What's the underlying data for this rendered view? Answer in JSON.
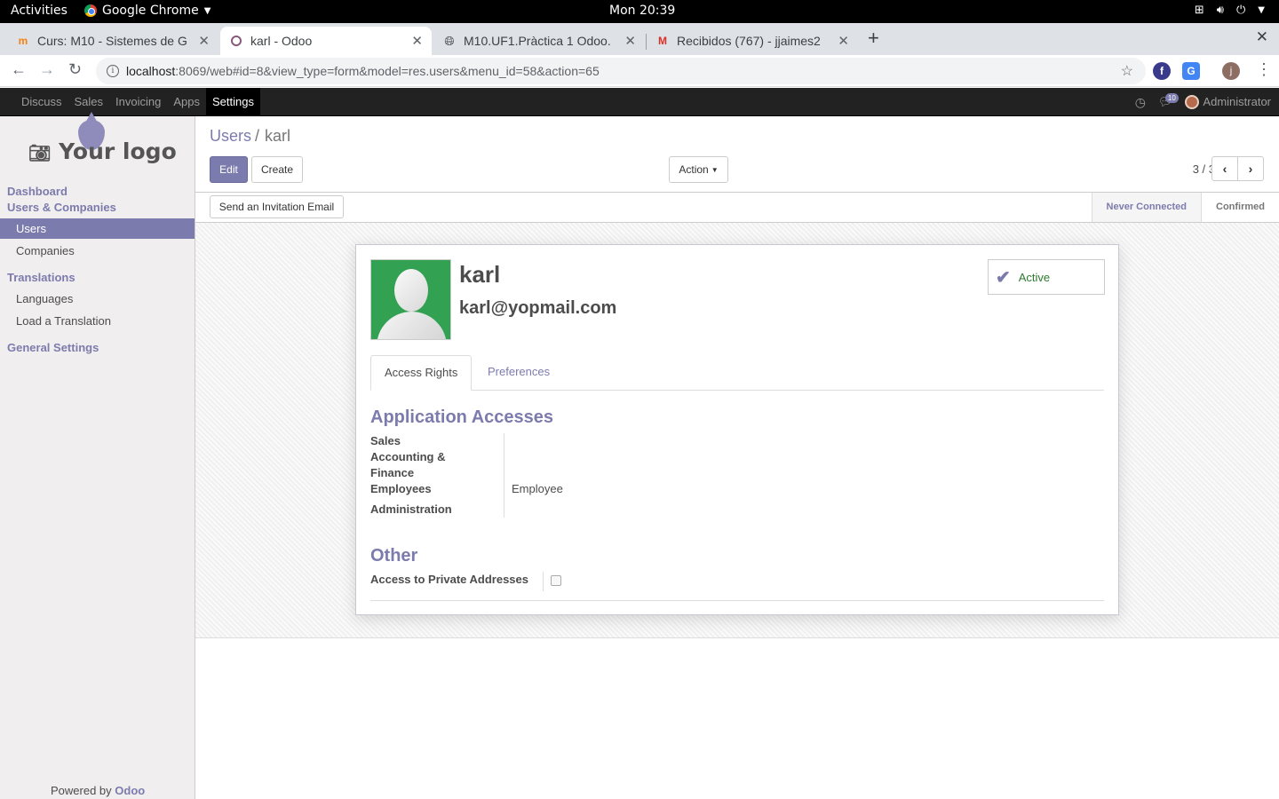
{
  "os": {
    "activities": "Activities",
    "app_name": "Google Chrome",
    "clock": "Mon 20:39"
  },
  "browser": {
    "tabs": [
      {
        "title": "Curs: M10 - Sistemes de G",
        "icon": "moodle-icon"
      },
      {
        "title": "karl - Odoo",
        "icon": "odoo-icon"
      },
      {
        "title": "M10.UF1.Pràctica 1 Odoo.",
        "icon": "globe-icon"
      },
      {
        "title": "Recibidos (767) - jjaimes2",
        "icon": "gmail-icon"
      }
    ],
    "url_host": "localhost",
    "url_path": ":8069/web#id=8&view_type=form&model=res.users&menu_id=58&action=65",
    "profile_initial": "j"
  },
  "odoo_nav": {
    "menus": [
      "Discuss",
      "Sales",
      "Invoicing",
      "Apps",
      "Settings"
    ],
    "active_menu": "Settings",
    "chat_count": "10",
    "user": "Administrator"
  },
  "sidebar": {
    "logo_text": "Your logo",
    "sections": {
      "dashboard": "Dashboard",
      "users_companies": "Users & Companies",
      "translations": "Translations",
      "general_settings": "General Settings"
    },
    "items": {
      "users": "Users",
      "companies": "Companies",
      "languages": "Languages",
      "load_translation": "Load a Translation"
    },
    "powered_prefix": "Powered by",
    "powered_brand": "Odoo"
  },
  "control_panel": {
    "breadcrumb_parent": "Users",
    "breadcrumb_sep": "/",
    "breadcrumb_current": "karl",
    "edit": "Edit",
    "create": "Create",
    "action": "Action",
    "pager": "3 / 3"
  },
  "statusbar": {
    "send_invite": "Send an Invitation Email",
    "steps": [
      "Never Connected",
      "Confirmed"
    ],
    "current_step": "Never Connected"
  },
  "form": {
    "name": "karl",
    "login": "karl@yopmail.com",
    "active_label": "Active",
    "tabs": [
      "Access Rights",
      "Preferences"
    ],
    "app_access_title": "Application Accesses",
    "labels": {
      "sales": "Sales",
      "accounting_1": "Accounting &",
      "accounting_2": "Finance",
      "employees": "Employees",
      "administration": "Administration"
    },
    "employees_value": "Employee",
    "other_title": "Other",
    "private_addresses_label": "Access to Private Addresses",
    "private_addresses_checked": false
  }
}
